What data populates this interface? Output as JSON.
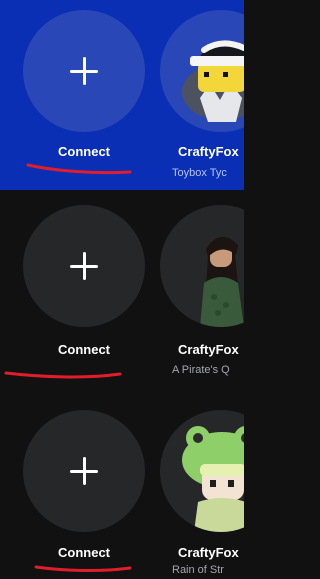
{
  "colors": {
    "highlight_bg": "#0b2fb4",
    "dark_bg": "#111112",
    "circle_on_highlight": "#2a47b8",
    "circle_on_dark": "#262729",
    "annotation_red": "#e01d2b"
  },
  "sections": [
    {
      "highlighted": true,
      "connect": {
        "icon": "plus-icon",
        "label": "Connect"
      },
      "friend": {
        "name": "CraftyFox",
        "status": "Toybox Tyc",
        "avatar": "avatar-ninja-headband"
      }
    },
    {
      "highlighted": false,
      "connect": {
        "icon": "plus-icon",
        "label": "Connect"
      },
      "friend": {
        "name": "CraftyFox",
        "status": "A Pirate's Q",
        "avatar": "avatar-green-dress-girl"
      }
    },
    {
      "highlighted": false,
      "connect": {
        "icon": "plus-icon",
        "label": "Connect"
      },
      "friend": {
        "name": "CraftyFox",
        "status": "Rain of Str",
        "avatar": "avatar-frog-hat"
      }
    }
  ]
}
